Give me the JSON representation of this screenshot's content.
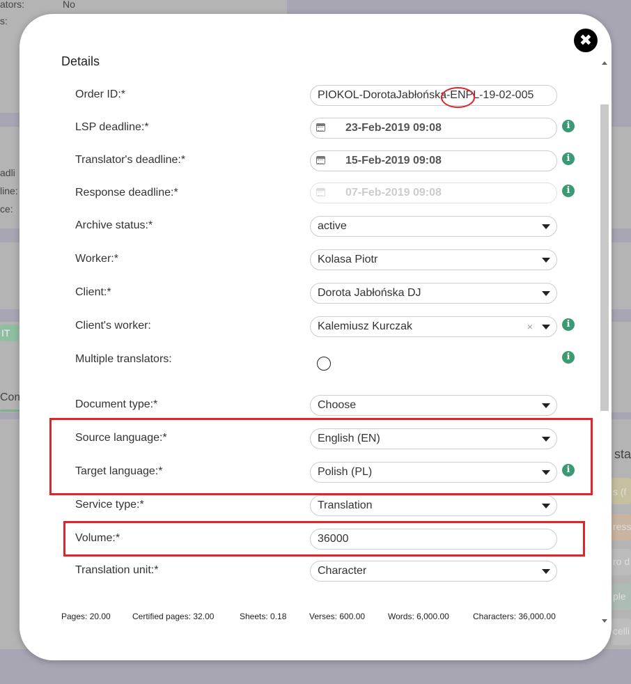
{
  "background": {
    "snippets": [
      "ators:",
      "No",
      "s:",
      "adli",
      "line:",
      "ce:",
      "IT",
      "Com",
      "sta",
      "s (f",
      "ress",
      "ro d",
      "ple",
      "celli"
    ]
  },
  "modal": {
    "section_title": "Details",
    "fields": {
      "order_id": {
        "label": "Order ID:*",
        "value": "PIOKOL-DorotaJabłońska-ENPL-19-02-005"
      },
      "lsp_deadline": {
        "label": "LSP deadline:*",
        "value": "23-Feb-2019 09:08"
      },
      "translator_deadline": {
        "label": "Translator's deadline:*",
        "value": "15-Feb-2019 09:08"
      },
      "response_deadline": {
        "label": "Response deadline:*",
        "value": "07-Feb-2019 09:08"
      },
      "archive_status": {
        "label": "Archive status:*",
        "value": "active"
      },
      "worker": {
        "label": "Worker:*",
        "value": "Kolasa Piotr"
      },
      "client": {
        "label": "Client:*",
        "value": "Dorota Jabłońska DJ"
      },
      "clients_worker": {
        "label": "Client's worker:",
        "value": "Kalemiusz Kurczak",
        "clear": "×"
      },
      "multiple_translators": {
        "label": "Multiple translators:"
      },
      "document_type": {
        "label": "Document type:*",
        "value": "Choose"
      },
      "source_language": {
        "label": "Source language:*",
        "value": "English (EN)"
      },
      "target_language": {
        "label": "Target language:*",
        "value": "Polish (PL)"
      },
      "service_type": {
        "label": "Service type:*",
        "value": "Translation"
      },
      "volume": {
        "label": "Volume:*",
        "value": "36000"
      },
      "translation_unit": {
        "label": "Translation unit:*",
        "value": "Character"
      }
    },
    "stats": {
      "pages": "Pages: 20.00",
      "certified_pages": "Certified pages: 32.00",
      "sheets": "Sheets: 0.18",
      "verses": "Verses: 600.00",
      "words": "Words: 6,000.00",
      "characters": "Characters: 36,000.00"
    },
    "icons": {
      "close": "close-icon",
      "info": "info-icon",
      "calendar": "calendar-icon"
    },
    "colors": {
      "info_icon": "#3a9b73",
      "highlight": "#e0242c",
      "overlay": "#a9a6b4"
    }
  }
}
